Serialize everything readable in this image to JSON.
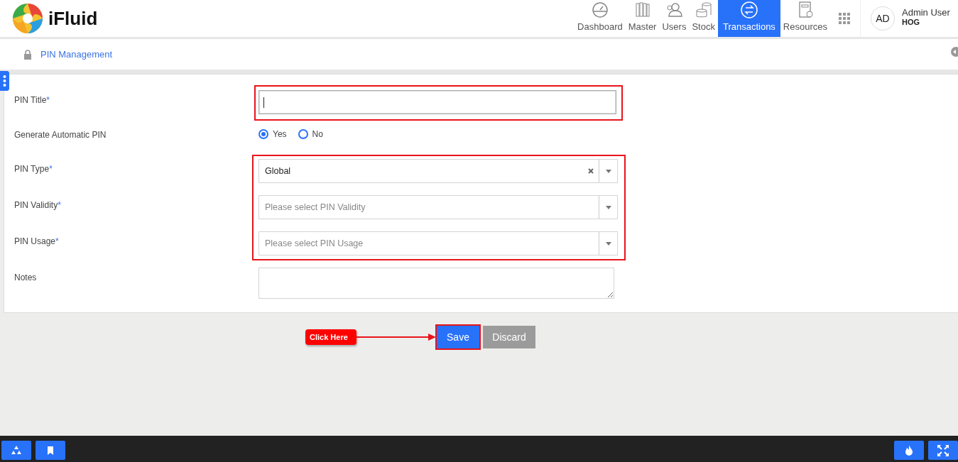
{
  "app": {
    "name": "iFluid"
  },
  "nav": [
    {
      "label": "Dashboard",
      "selected": false
    },
    {
      "label": "Master",
      "selected": false
    },
    {
      "label": "Users",
      "selected": false
    },
    {
      "label": "Stock",
      "selected": false
    },
    {
      "label": "Transactions",
      "selected": true
    },
    {
      "label": "Resources",
      "selected": false
    }
  ],
  "user": {
    "initials": "AD",
    "name": "Admin User",
    "role": "HOG"
  },
  "breadcrumb": {
    "title": "PIN Management"
  },
  "form": {
    "fields": [
      {
        "kind": "text",
        "label": "PIN Title",
        "required_mark": "*",
        "focused": true
      },
      {
        "kind": "radio",
        "label": "Generate Automatic PIN",
        "options": [
          {
            "label": "Yes",
            "selected": true
          },
          {
            "label": "No",
            "selected": false
          }
        ]
      },
      {
        "kind": "select",
        "label": "PIN Type",
        "required_mark": "*",
        "value": "Global",
        "clearable": true
      },
      {
        "kind": "select",
        "label": "PIN Validity",
        "required_mark": "*",
        "placeholder": "Please select PIN Validity"
      },
      {
        "kind": "select",
        "label": "PIN Usage",
        "required_mark": "*",
        "placeholder": "Please select PIN Usage"
      },
      {
        "kind": "textarea",
        "label": "Notes"
      }
    ],
    "buttons": [
      {
        "label": "Save",
        "kind": "primary"
      },
      {
        "label": "Discard",
        "kind": "secondary"
      }
    ]
  },
  "annotation": {
    "callout": "Click Here"
  }
}
